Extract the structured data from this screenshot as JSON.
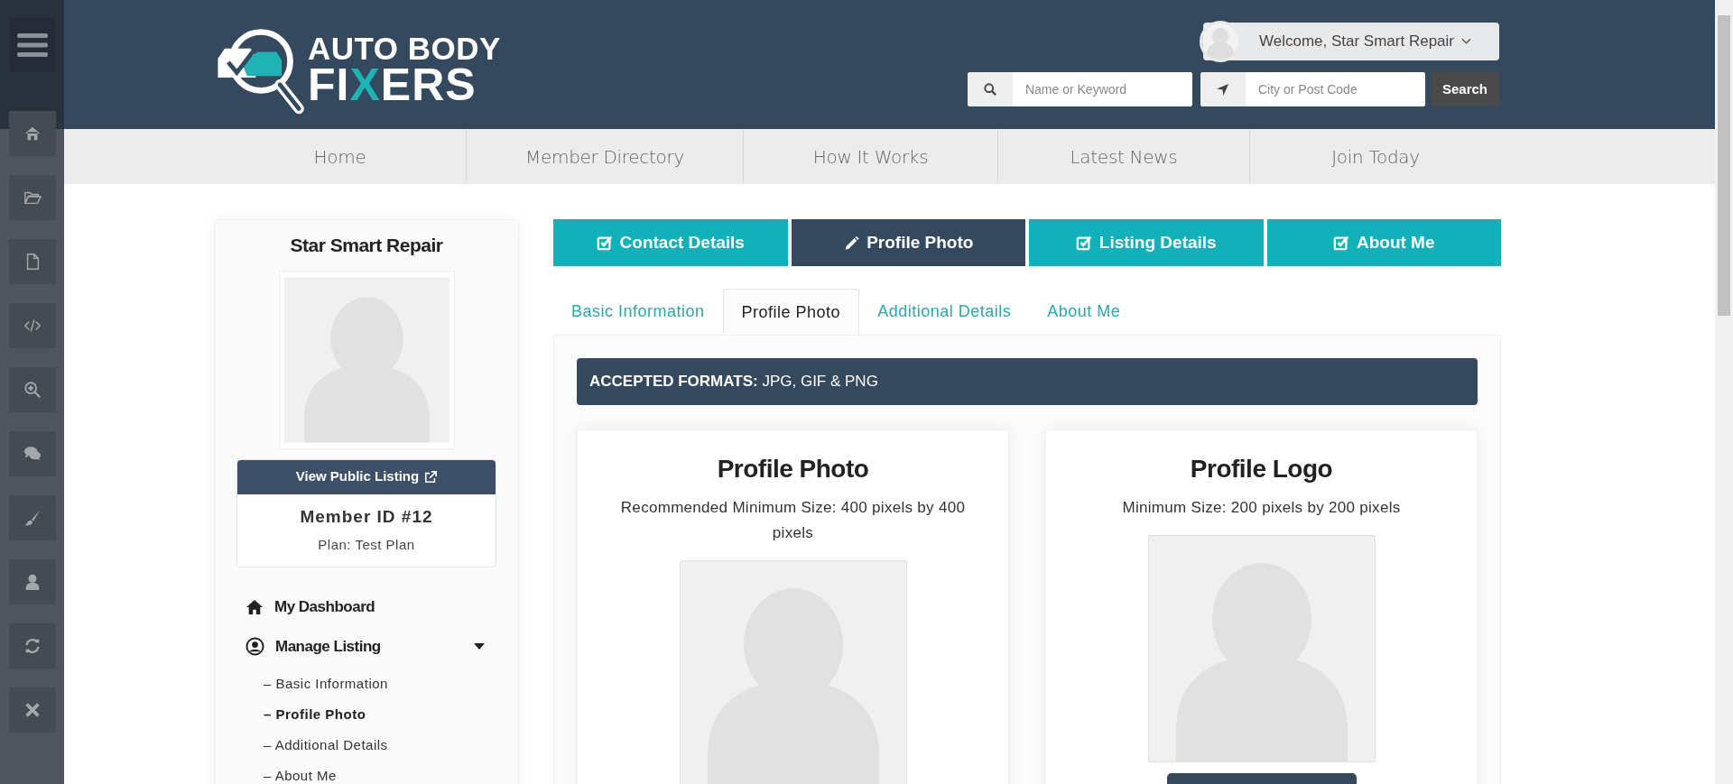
{
  "header": {
    "logo": {
      "line1": "AUTO BODY",
      "line2": [
        {
          "text": "FI",
          "accent": false
        },
        {
          "text": "X",
          "accent": true
        },
        {
          "text": "ERS",
          "accent": false
        }
      ]
    },
    "user_menu": {
      "greeting": "Welcome, Star Smart Repair"
    },
    "search": {
      "keyword_placeholder": "Name or Keyword",
      "location_placeholder": "City or Post Code",
      "button": "Search"
    }
  },
  "nav": [
    "Home",
    "Member Directory",
    "How It Works",
    "Latest News",
    "Join Today"
  ],
  "profile_card": {
    "name": "Star Smart Repair",
    "button": "View Public Listing",
    "member_id": "Member ID #12",
    "plan": "Plan: Test Plan"
  },
  "menu": [
    {
      "label": "My Dashboard",
      "kind": "home"
    },
    {
      "label": "Manage Listing",
      "kind": "user",
      "expanded": true,
      "children": [
        {
          "label": "– Basic Information",
          "selected": false
        },
        {
          "label": "– Profile Photo",
          "selected": true
        },
        {
          "label": "– Additional Details",
          "selected": false
        },
        {
          "label": "– About Me",
          "selected": false
        }
      ]
    }
  ],
  "step_tabs": [
    {
      "label": "Contact Details",
      "selected": false
    },
    {
      "label": "Profile Photo",
      "selected": true
    },
    {
      "label": "Listing Details",
      "selected": false
    },
    {
      "label": "About Me",
      "selected": false
    }
  ],
  "sub_tabs": [
    {
      "label": "Basic Information",
      "selected": false
    },
    {
      "label": "Profile Photo",
      "selected": true
    },
    {
      "label": "Additional Details",
      "selected": false
    },
    {
      "label": "About Me",
      "selected": false
    }
  ],
  "formats_banner": "**ACCEPTED FORMATS:** JPG, GIF & PNG",
  "upload_cards": [
    {
      "title": "Profile Photo",
      "description": "Recommended Minimum Size: 400 pixels by 400 pixels"
    },
    {
      "title": "Profile Logo",
      "description": "Minimum Size: 200 pixels by 200 pixels"
    }
  ]
}
